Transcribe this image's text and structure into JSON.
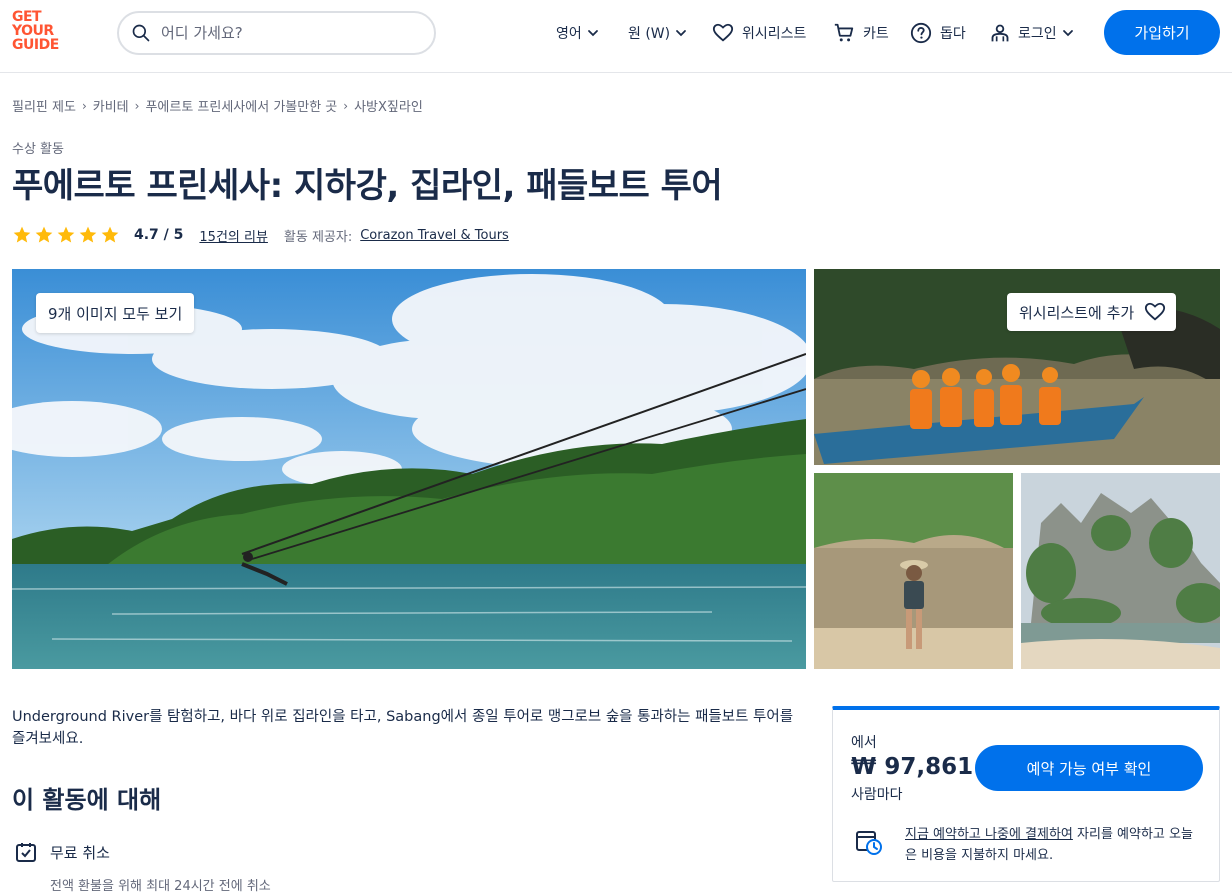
{
  "header": {
    "logo": [
      "GET",
      "YOUR",
      "GUIDE"
    ],
    "search_placeholder": "어디 가세요?",
    "language": "영어",
    "currency": "원 (W)",
    "wishlist": "위시리스트",
    "cart": "카트",
    "help": "돕다",
    "login": "로그인",
    "signup": "가입하기"
  },
  "breadcrumb": [
    "필리핀 제도",
    "카비테",
    "푸에르토 프린세사에서 가볼만한 곳",
    "사방X짚라인"
  ],
  "category": "수상 활동",
  "title": "푸에르토 프린세사: 지하강, 집라인, 패들보트 투어",
  "rating": {
    "stars": 5,
    "value": "4.7 / 5",
    "reviews": "15건의 리뷰",
    "provider_label": "활동 제공자:",
    "provider": "Corazon Travel & Tours"
  },
  "gallery": {
    "view_all": "9개 이미지 모두 보기",
    "add_wishlist": "위시리스트에 추가"
  },
  "description": "Underground River를 탐험하고, 바다 위로 집라인을 타고, Sabang에서 종일 투어로 맹그로브 숲을 통과하는 패들보트 투어를 즐겨보세요.",
  "about": {
    "title": "이 활동에 대해",
    "feature_title": "무료 취소",
    "feature_sub": "전액 환불을 위해 최대 24시간 전에 취소"
  },
  "booking": {
    "from": "에서",
    "price": "₩ 97,861",
    "per": "사람마다",
    "check_button": "예약 가능 여부 확인",
    "reserve_link": "지금 예약하고 나중에 결제하여",
    "reserve_text": " 자리를 예약하고 오늘은 비용을 지불하지 마세요."
  },
  "colors": {
    "primary": "#0071eb",
    "brand": "#ff5533",
    "star": "#ffba0a",
    "text": "#1a2b49"
  }
}
